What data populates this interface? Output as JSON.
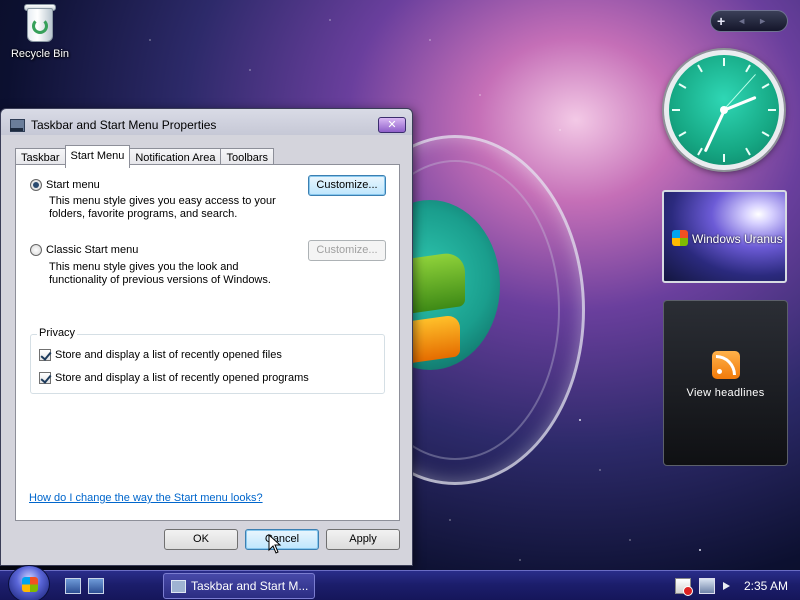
{
  "desktop": {
    "recycle_bin_label": "Recycle Bin"
  },
  "sidebar": {
    "add_gadget": "+",
    "prev": "◄",
    "next": "►",
    "slideshow_caption": "Windows Uranus",
    "feed_label": "View headlines"
  },
  "dialog": {
    "title": "Taskbar and Start Menu Properties",
    "close_label": "✕",
    "tabs": [
      {
        "label": "Taskbar",
        "active": false
      },
      {
        "label": "Start Menu",
        "active": true
      },
      {
        "label": "Notification Area",
        "active": false
      },
      {
        "label": "Toolbars",
        "active": false
      }
    ],
    "start_menu_option": {
      "label": "Start menu",
      "selected": true,
      "description_line1": "This menu style gives you easy access to your",
      "description_line2": "folders, favorite programs, and search.",
      "customize_label": "Customize..."
    },
    "classic_option": {
      "label": "Classic Start menu",
      "selected": false,
      "description_line1": "This menu style gives you the look and",
      "description_line2": "functionality of previous versions of Windows.",
      "customize_label": "Customize..."
    },
    "privacy": {
      "group_label": "Privacy",
      "store_files_label": "Store and display a list of recently opened files",
      "store_files_checked": true,
      "store_programs_label": "Store and display a list of recently opened programs",
      "store_programs_checked": true
    },
    "help_link": "How do I change the way the Start menu looks?",
    "ok_label": "OK",
    "cancel_label": "Cancel",
    "apply_label": "Apply"
  },
  "taskbar": {
    "task_button_label": "Taskbar and Start M...",
    "time": "2:35 AM"
  },
  "colors": {
    "taskbar": "#1c1e6c",
    "accent": "#0066cc",
    "clock_face": "#16a884"
  }
}
